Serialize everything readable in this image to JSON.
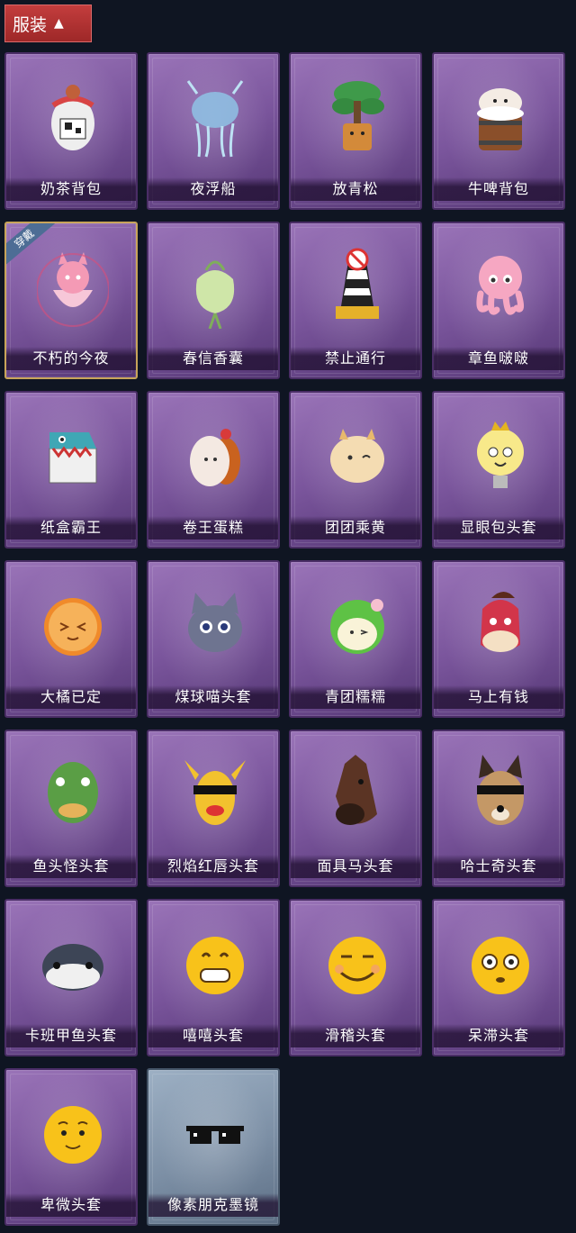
{
  "header": {
    "title": "服装",
    "toggle_icon": "chevron-up-icon"
  },
  "badge_text": "穿戴",
  "items": [
    {
      "name": "奶茶背包",
      "icon": "milk-tea-backpack-icon"
    },
    {
      "name": "夜浮船",
      "icon": "jellyfish-icon"
    },
    {
      "name": "放青松",
      "icon": "pine-tree-icon"
    },
    {
      "name": "牛啤背包",
      "icon": "beer-barrel-cow-icon"
    },
    {
      "name": "不朽的今夜",
      "icon": "pink-fox-cup-icon"
    },
    {
      "name": "春信香囊",
      "icon": "green-sachet-icon"
    },
    {
      "name": "禁止通行",
      "icon": "no-entry-barrier-icon"
    },
    {
      "name": "章鱼啵啵",
      "icon": "pink-octopus-icon"
    },
    {
      "name": "纸盒霸王",
      "icon": "box-dinosaur-icon"
    },
    {
      "name": "卷王蛋糕",
      "icon": "roll-cake-icon"
    },
    {
      "name": "团团乘黄",
      "icon": "fluffy-beast-icon"
    },
    {
      "name": "显眼包头套",
      "icon": "lightbulb-head-icon"
    },
    {
      "name": "大橘已定",
      "icon": "orange-slice-icon"
    },
    {
      "name": "煤球喵头套",
      "icon": "grey-cat-head-icon"
    },
    {
      "name": "青团糯糯",
      "icon": "green-rice-ball-icon"
    },
    {
      "name": "马上有钱",
      "icon": "red-horse-head-icon"
    },
    {
      "name": "鱼头怪头套",
      "icon": "fish-head-icon"
    },
    {
      "name": "烈焰红唇头套",
      "icon": "yellow-mask-sunglasses-icon"
    },
    {
      "name": "面具马头套",
      "icon": "horse-mask-icon"
    },
    {
      "name": "哈士奇头套",
      "icon": "husky-head-icon"
    },
    {
      "name": "卡班甲鱼头套",
      "icon": "whale-head-icon"
    },
    {
      "name": "嘻嘻头套",
      "icon": "grin-emoji-icon"
    },
    {
      "name": "滑稽头套",
      "icon": "smirk-emoji-icon"
    },
    {
      "name": "呆滞头套",
      "icon": "stare-emoji-icon"
    },
    {
      "name": "卑微头套",
      "icon": "shy-emoji-icon"
    },
    {
      "name": "像素朋克墨镜",
      "icon": "pixel-sunglasses-icon"
    }
  ],
  "equipped_index": 4,
  "grey_index": 25,
  "colors": {
    "header_bg": "#b83333",
    "card_purple": "#7a559c",
    "card_grey": "#7c8fa5",
    "equipped_border": "#c8a45a",
    "page_bg": "#0f1522"
  }
}
